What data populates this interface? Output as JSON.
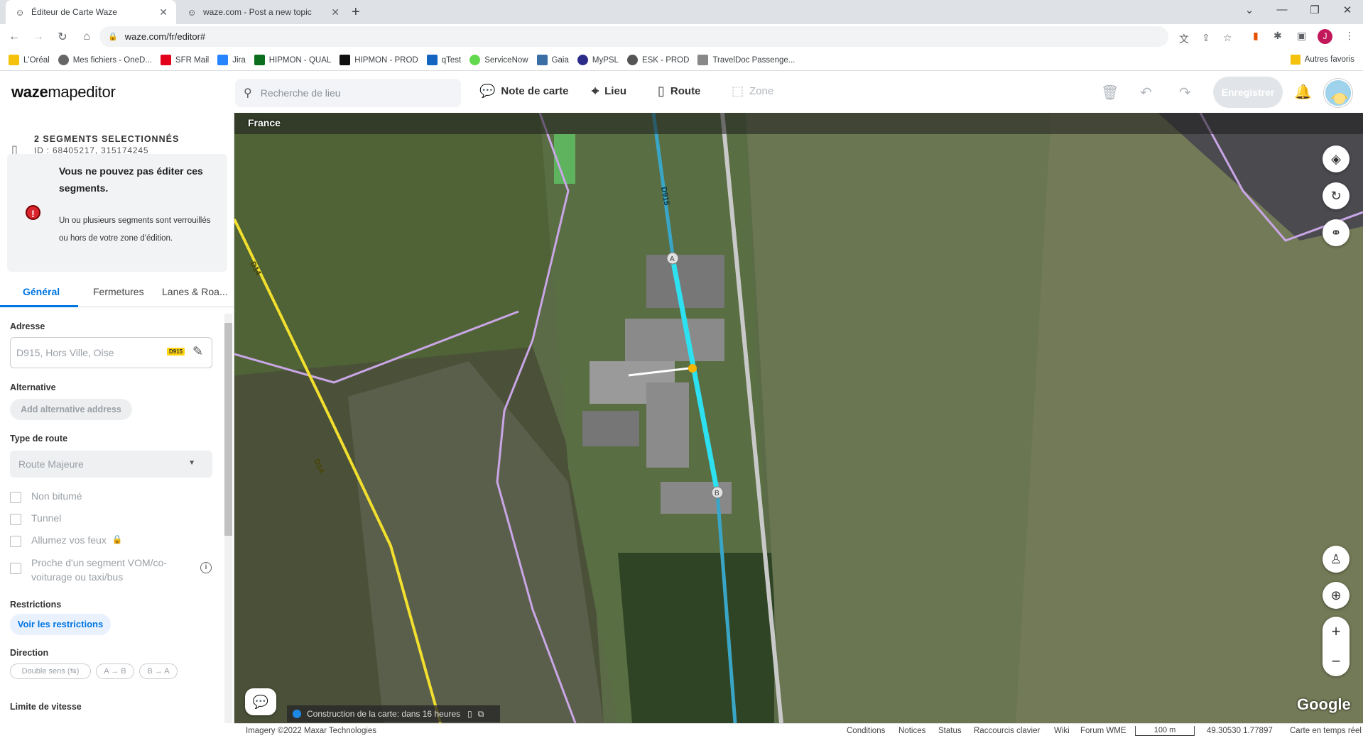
{
  "browser": {
    "tabs": [
      {
        "title": "Éditeur de Carte Waze",
        "active": true
      },
      {
        "title": "waze.com - Post a new topic",
        "active": false
      }
    ],
    "url": "waze.com/fr/editor#",
    "profile_initial": "J",
    "bookmarks": [
      {
        "label": "L'Oréal",
        "color": "#f4c20d"
      },
      {
        "label": "Mes fichiers - OneD...",
        "color": "#666666"
      },
      {
        "label": "SFR Mail",
        "color": "#e2001a"
      },
      {
        "label": "Jira",
        "color": "#2684ff"
      },
      {
        "label": "HIPMON - QUAL",
        "color": "#0b6e1e"
      },
      {
        "label": "HIPMON - PROD",
        "color": "#111111"
      },
      {
        "label": "qTest",
        "color": "#1565c0"
      },
      {
        "label": "ServiceNow",
        "color": "#62d84e"
      },
      {
        "label": "Gaia",
        "color": "#3b6ea5"
      },
      {
        "label": "MyPSL",
        "color": "#2b2b8a"
      },
      {
        "label": "ESK - PROD",
        "color": "#555555"
      },
      {
        "label": "TravelDoc Passenge...",
        "color": "#888888"
      }
    ],
    "other_bookmarks": "Autres favoris"
  },
  "wme": {
    "logo_bold": "waze",
    "logo_rest": "mapeditor",
    "search_placeholder": "Recherche de lieu",
    "tools": {
      "map_note": "Note de carte",
      "place": "Lieu",
      "road": "Route",
      "zone": "Zone"
    },
    "save_label": "Enregistrer"
  },
  "sidebar": {
    "selection_title": "2 SEGMENTS SELECTIONNÉS",
    "selection_ids": "ID : 68405217, 315174245",
    "alert_title": "Vous ne pouvez pas éditer ces segments.",
    "alert_body": "Un ou plusieurs segments sont verrouillés ou hors de votre zone d'édition.",
    "tabs": [
      "Général",
      "Fermetures",
      "Lanes & Roa..."
    ],
    "address_label": "Adresse",
    "address_value": "D915, Hors Ville, Oise",
    "address_shield": "D915",
    "alternative_label": "Alternative",
    "add_alt_label": "Add alternative address",
    "road_type_label": "Type de route",
    "road_type_value": "Route Majeure",
    "checkboxes": [
      "Non bitumé",
      "Tunnel",
      "Allumez vos feux",
      "Proche d'un segment VOM/co-voiturage ou taxi/bus"
    ],
    "restrictions_label": "Restrictions",
    "restrictions_button": "Voir les restrictions",
    "direction_label": "Direction",
    "direction_options": [
      "Double sens (⇆)",
      "A → B",
      "B → A"
    ],
    "speed_label": "Limite de vitesse"
  },
  "map": {
    "country": "France",
    "road_labels": {
      "d915": "D915",
      "d14_top": "D14",
      "d14_bottom": "D14"
    },
    "node_a": "A",
    "node_b": "B",
    "build_text": "Construction de la carte: dans 16 heures",
    "google": "Google"
  },
  "footer": {
    "imagery": "Imagery ©2022 Maxar Technologies",
    "links": [
      "Conditions",
      "Notices",
      "Status",
      "Raccourcis clavier",
      "Wiki",
      "Forum WME"
    ],
    "scale": "100 m",
    "coords": "49.30530 1.77897",
    "realtime": "Carte en temps réel"
  }
}
